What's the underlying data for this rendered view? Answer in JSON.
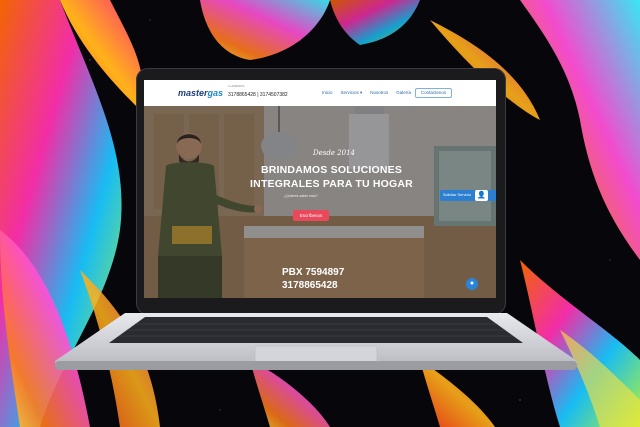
{
  "site": {
    "logo_primary": "master",
    "logo_secondary": "gas",
    "phone_label": "LLAMENOS",
    "phones": "3178865428 | 3174507382",
    "nav": [
      "Inicio",
      "Servicios ▾",
      "Nosotros",
      "Galería"
    ],
    "contact_button": "Contactenos"
  },
  "hero": {
    "since": "Desde 2014",
    "headline_line1": "BRINDAMOS SOLUCIONES",
    "headline_line2": "INTEGRALES PARA TU HOGAR",
    "subheadline": "¿Quieres saber más?",
    "cta": "Escríbenos",
    "pbx": "PBX 7594897",
    "mobile": "3178865428",
    "side_button": "Solicitar Servicio"
  },
  "icons": {
    "side": "user-icon",
    "chat": "chat-icon"
  },
  "colors": {
    "brand_blue": "#1e3f78",
    "accent_blue": "#2b7fd0",
    "cta_red": "#e9495a"
  }
}
